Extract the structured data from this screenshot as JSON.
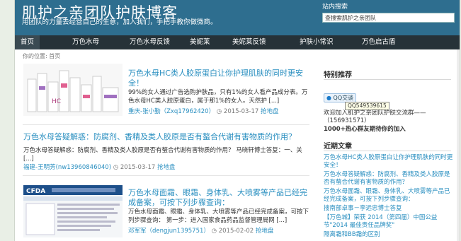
{
  "header": {
    "title": "肌护之亲团队护肤博客",
    "description": "用团队的力量去经营自己的生意，加入我们，手把手教你做微商。"
  },
  "search": {
    "title": "站内搜索",
    "value": "查搜索肌护之亲团队"
  },
  "nav": {
    "items": [
      "首页",
      "万色水母",
      "万色水母反馈",
      "美妮莱",
      "美妮莱反馈",
      "护肤小常识",
      "万色启古盾"
    ]
  },
  "breadcrumb": "你的位置: 首页",
  "posts": [
    {
      "title": "万色水母HC类人胶原蛋白让你护理肌肤的同时更安全！",
      "excerpt": "99%的女人通过广告选购护肤品，只有1%的女人看产品成分表。万色水母HC类人胶原蛋白，属于那1%的女人。天然护 [...]",
      "author": "重庆-张小勤（Zxq17962420）",
      "date": "2015-03-17",
      "tag": "抢地盘",
      "thumb_text": "HC"
    },
    {
      "title": "万色水母答疑解惑：防腐剂、香精及类人胶原是否有螯合代谢有害物质的作用？",
      "excerpt": "万色水母答疑解惑：防腐剂、香精及类人胶原是否有螯合代谢有害物质的作用？ 马晓轩博士答复：一、关 [...]",
      "author": "福建-王明芳(nw13960846040)",
      "date": "2015-03-17",
      "tag": "抢地盘"
    },
    {
      "title": "万色水母面霜、眼霜、身体乳、大喷雾等产品已经完成备案，可按下列步骤查询：",
      "excerpt": "万色水母面霜、眼霜、身体乳、大喷雾等产品已经完成备案，可按下列步骤查询： 第一步：进入国家食品药品监督管理局网 [...]",
      "author": "邓军军（dengjun1395751）",
      "date": "2015-02-02",
      "tag": "抢地盘",
      "thumb_text": "CFDA"
    }
  ],
  "sidebar": {
    "recommend_title": "特别推荐",
    "qq_label": "QQ交谈",
    "qq_tooltip": "QQ549539615",
    "recommend_text": "欢迎加入肌护之亲团队护肤交流群——（156931571）",
    "recommend_extra": "1000+热心群友期待你的加入",
    "recent_title": "近期文章",
    "recent": [
      "万色水母HC类人胶原蛋白让你护理肌肤的同时更安全！",
      "万色水母答疑解惑：防腐剂、香精及类人胶原是否有螯合代谢有害物质的作用？",
      "万色水母面霜、眼霜、身体乳、大喷雾等产品已经完成备案，可按下列步骤查询：",
      "搜南部卓事－李远忠博士答复",
      "【万色城】荣获 2014（第四届）中国公益节\"2014 最佳责任品牌奖\"",
      "隔离霜和BB霜的区别"
    ]
  },
  "colors": {
    "header_bg": "#2e6e8f",
    "nav_bg": "#263238",
    "link": "#2a8fc0"
  }
}
